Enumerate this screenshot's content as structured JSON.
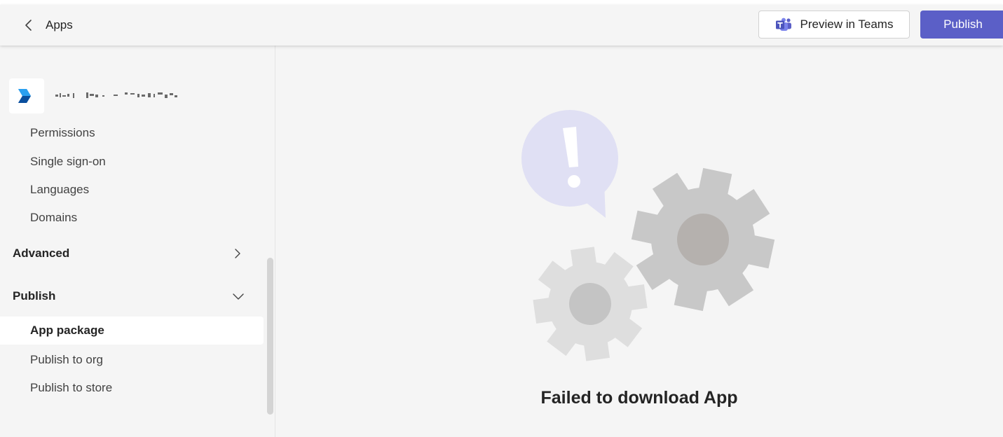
{
  "header": {
    "back_label": "Apps",
    "preview_label": "Preview in Teams",
    "publish_label": "Publish"
  },
  "sidebar": {
    "items": [
      {
        "label": "Permissions"
      },
      {
        "label": "Single sign-on"
      },
      {
        "label": "Languages"
      },
      {
        "label": "Domains"
      }
    ],
    "sections": [
      {
        "label": "Advanced",
        "state": "collapsed"
      },
      {
        "label": "Publish",
        "state": "expanded"
      }
    ],
    "publish_items": [
      {
        "label": "App package",
        "selected": true
      },
      {
        "label": "Publish to org"
      },
      {
        "label": "Publish to store"
      }
    ]
  },
  "main": {
    "error_message": "Failed to download App"
  },
  "colors": {
    "accent": "#5b5fc7",
    "background": "#f5f5f5",
    "bubble": "#e0e0f4"
  },
  "icons": {
    "back": "chevron-left-icon",
    "teams": "teams-logo-icon",
    "app_logo": "power-automate-logo",
    "advanced": "chevron-right-icon",
    "publish": "chevron-down-icon",
    "illustration": "error-gears-illustration"
  }
}
